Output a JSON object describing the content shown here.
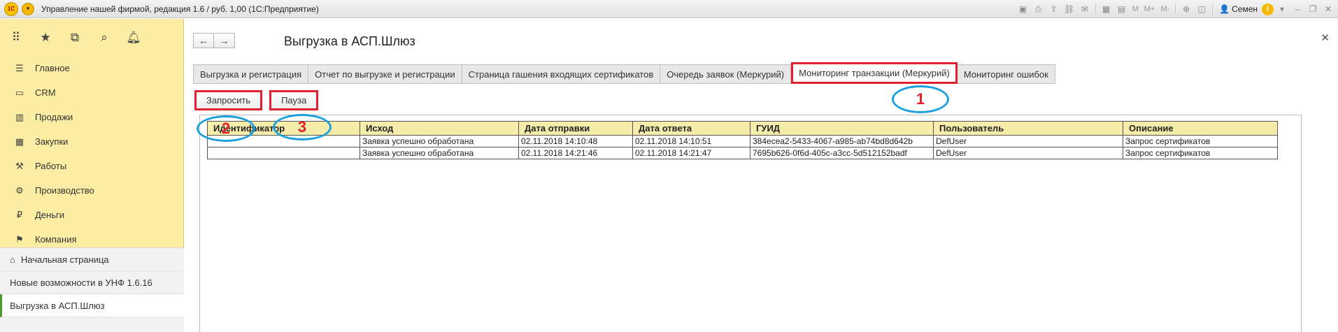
{
  "window": {
    "title": "Управление нашей фирмой, редакция 1.6 / руб. 1,00  (1С:Предприятие)",
    "logo_text": "1С",
    "menu_glyph": "▾",
    "user": "Семен",
    "info_glyph": "i",
    "m_label": "M",
    "m_plus_label": "M+",
    "m_minus_label": "M-"
  },
  "sidebar": {
    "tools": [
      "apps-icon",
      "star-icon",
      "history-icon",
      "search-icon",
      "bell-icon"
    ],
    "items": [
      {
        "label": "Главное",
        "icon": "list-icon"
      },
      {
        "label": "CRM",
        "icon": "crm-icon"
      },
      {
        "label": "Продажи",
        "icon": "sales-icon"
      },
      {
        "label": "Закупки",
        "icon": "purchases-icon"
      },
      {
        "label": "Работы",
        "icon": "works-icon"
      },
      {
        "label": "Производство",
        "icon": "production-icon"
      },
      {
        "label": "Деньги",
        "icon": "money-icon"
      },
      {
        "label": "Компания",
        "icon": "flag-icon"
      }
    ],
    "open_windows": [
      {
        "label": "Начальная страница",
        "icon": "home-icon"
      },
      {
        "label": "Новые возможности в УНФ 1.6.16"
      },
      {
        "label": "Выгрузка в АСП.Шлюз",
        "active": true
      }
    ]
  },
  "main": {
    "page_title": "Выгрузка в АСП.Шлюз",
    "tabs": [
      {
        "label": "Выгрузка и регистрация"
      },
      {
        "label": "Отчет по выгрузке и регистрации"
      },
      {
        "label": "Страница гашения входящих сертификатов"
      },
      {
        "label": "Очередь заявок (Меркурий)"
      },
      {
        "label": "Мониторинг транзакции (Меркурий)",
        "active": true
      },
      {
        "label": "Мониторинг ошибок"
      }
    ],
    "buttons": {
      "request": "Запросить",
      "pause": "Пауза"
    },
    "table": {
      "columns": [
        "Идентификатор",
        "Исход",
        "Дата отправки",
        "Дата ответа",
        "ГУИД",
        "Пользователь",
        "Описание"
      ],
      "rows": [
        [
          "",
          "Заявка успешно обработана",
          "02.11.2018 14:10:48",
          "02.11.2018 14:10:51",
          "384ecea2-5433-4067-a985-ab74bd8d642b",
          "DefUser",
          "Запрос сертификатов"
        ],
        [
          "",
          "Заявка успешно обработана",
          "02.11.2018 14:21:46",
          "02.11.2018 14:21:47",
          "7695b626-0f6d-405c-a3cc-5d512152badf",
          "DefUser",
          "Запрос сертификатов"
        ]
      ]
    }
  },
  "callouts": [
    "1",
    "2",
    "3"
  ],
  "colors": {
    "sidebar_bg": "#fbeda4",
    "highlight_red": "#e3202d",
    "callout_blue": "#1a9fe0",
    "table_header_bg": "#f7edaa"
  }
}
